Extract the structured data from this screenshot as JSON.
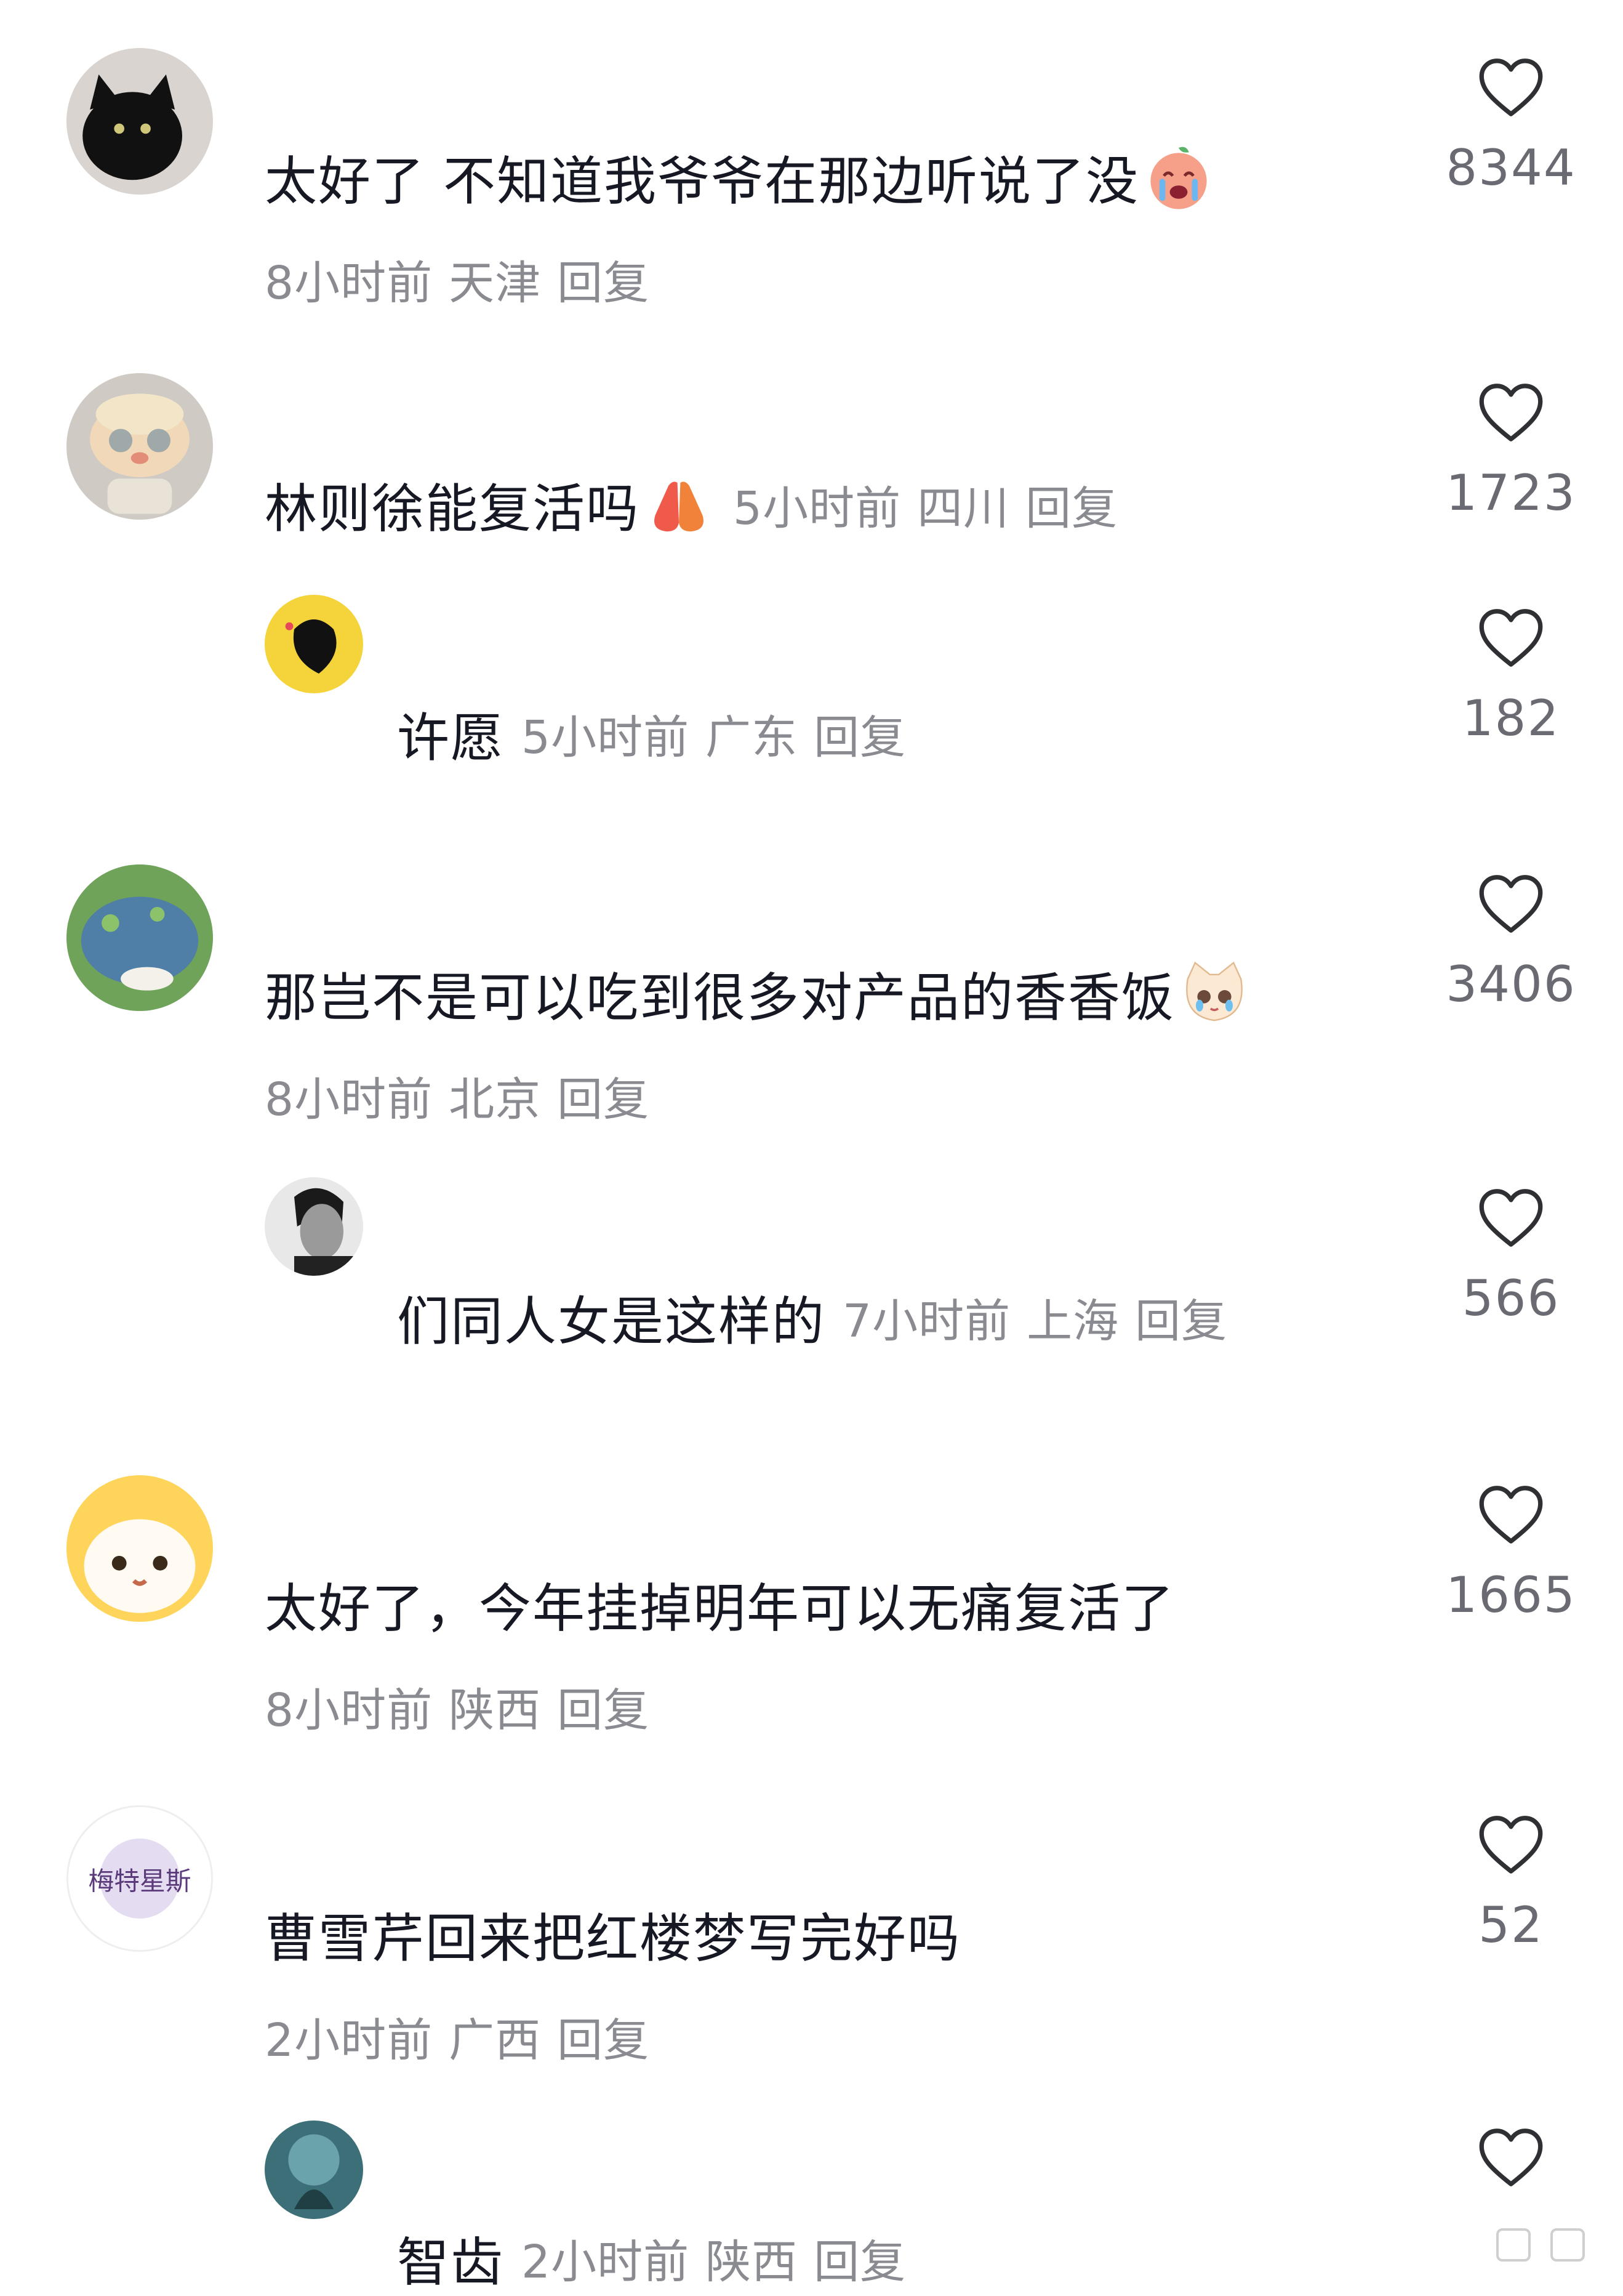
{
  "comments": [
    {
      "text": "太好了 不知道我爷爷在那边听说了没",
      "time": "8小时前",
      "location": "天津",
      "reply": "回复",
      "likes": "8344",
      "emoji": "crying-baby-emoji"
    },
    {
      "text": "林则徐能复活吗",
      "time": "5小时前",
      "location": "四川",
      "reply": "回复",
      "likes": "1723",
      "emoji": "pray-hands-emoji"
    },
    {
      "text": "许愿",
      "time": "5小时前",
      "location": "广东",
      "reply": "回复",
      "likes": "182"
    },
    {
      "text": "那岂不是可以吃到很多对产品的香香饭",
      "time": "8小时前",
      "location": "北京",
      "reply": "回复",
      "likes": "3406",
      "emoji": "crying-cat-emoji"
    },
    {
      "text": "们同人女是这样的",
      "time": "7小时前",
      "location": "上海",
      "reply": "回复",
      "likes": "566"
    },
    {
      "text": "太好了，今年挂掉明年可以无痛复活了",
      "time": "8小时前",
      "location": "陕西",
      "reply": "回复",
      "likes": "1665"
    },
    {
      "text": "曹雪芹回来把红楼梦写完好吗",
      "time": "2小时前",
      "location": "广西",
      "reply": "回复",
      "likes": "52"
    },
    {
      "text": "智齿",
      "time": "2小时前",
      "location": "陕西",
      "reply": "回复",
      "likes": ""
    }
  ],
  "avatar_text": "梅特星斯",
  "colors": {
    "text": "#161823",
    "meta": "#8a8b91",
    "count": "#6a6b72",
    "heart": "#2f3033"
  }
}
